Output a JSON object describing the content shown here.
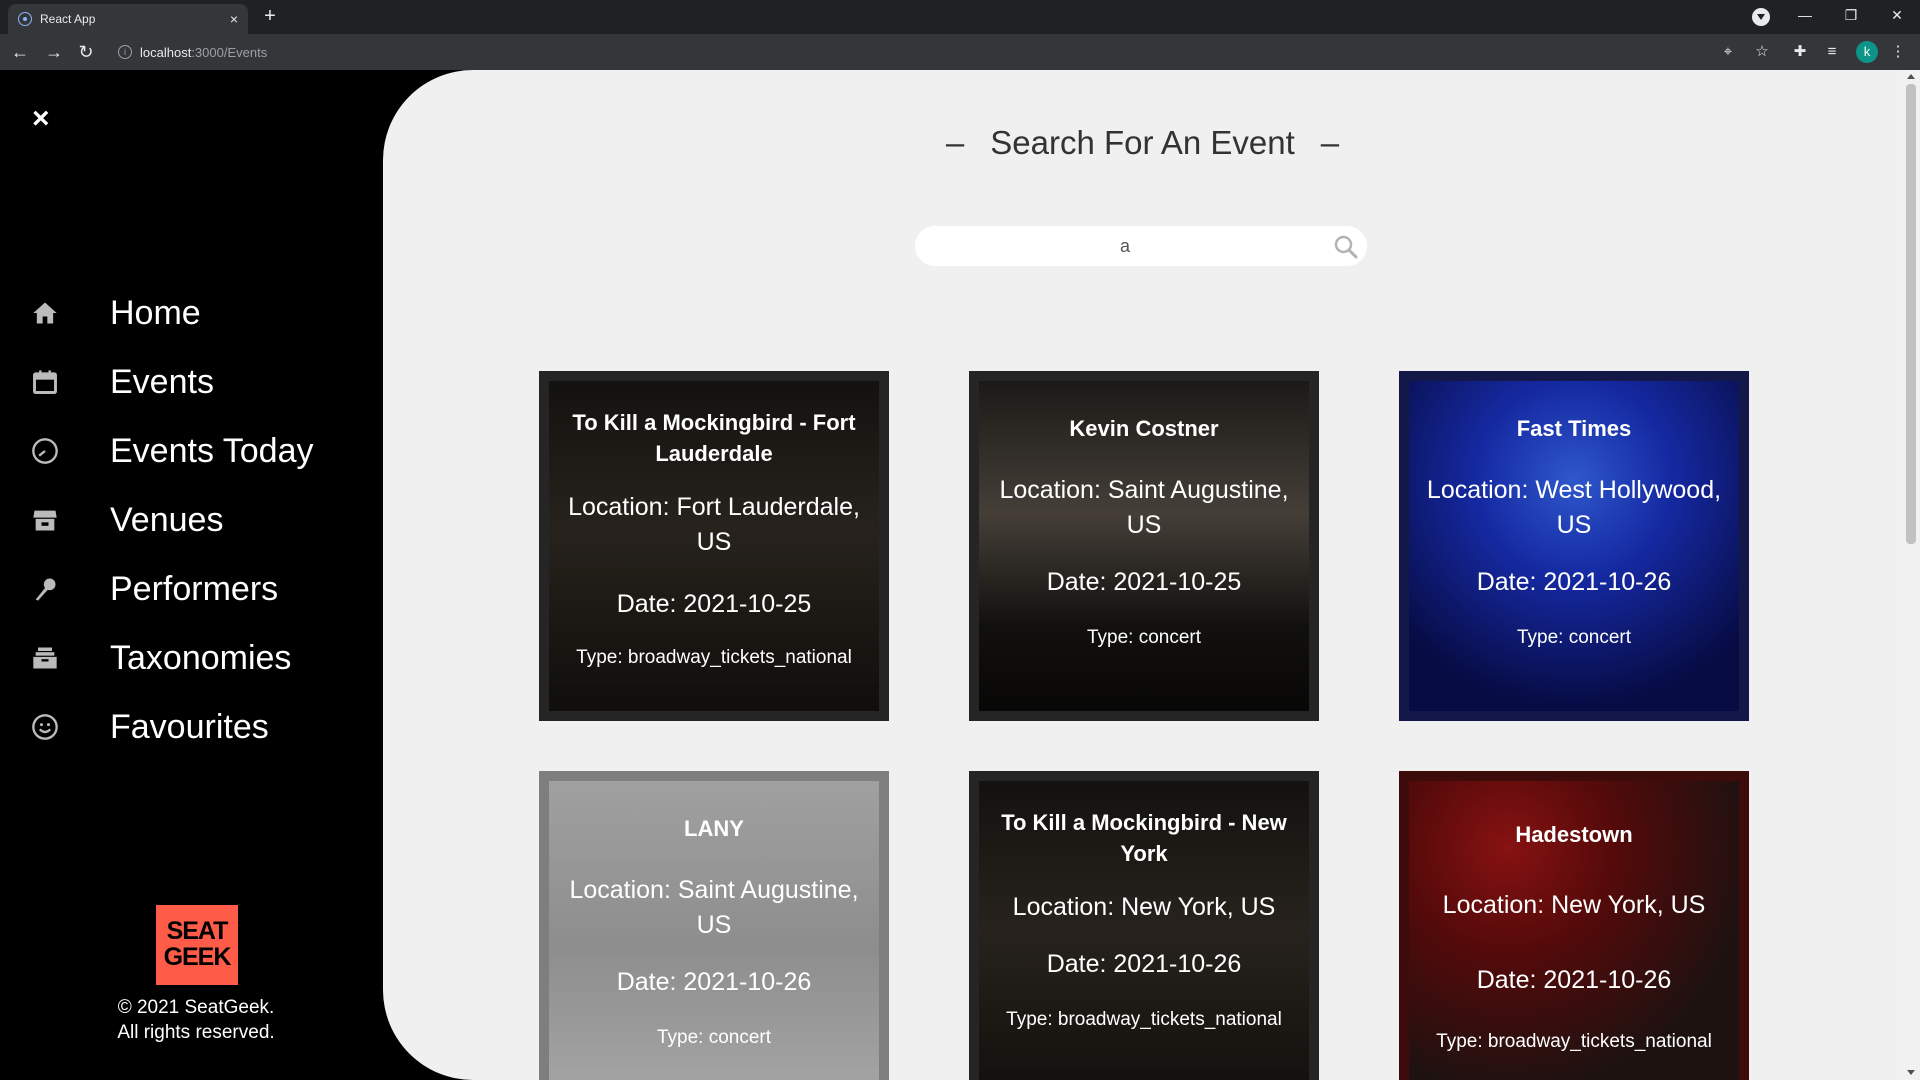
{
  "browser": {
    "tab_title": "React App",
    "tab_close": "×",
    "new_tab": "+",
    "url_host": "localhost",
    "url_path": ":3000/Events",
    "profile_initial": "k"
  },
  "sidebar": {
    "close_symbol": "×",
    "items": [
      {
        "label": "Home",
        "icon": "home-icon"
      },
      {
        "label": "Events",
        "icon": "calendar-icon"
      },
      {
        "label": "Events Today",
        "icon": "clock-icon"
      },
      {
        "label": "Venues",
        "icon": "store-icon"
      },
      {
        "label": "Performers",
        "icon": "microphone-icon"
      },
      {
        "label": "Taxonomies",
        "icon": "tray-icon"
      },
      {
        "label": "Favourites",
        "icon": "smiley-icon"
      }
    ],
    "logo_line1": "SEAT",
    "logo_line2": "GEEK",
    "copyright_line1": "© 2021 SeatGeek.",
    "copyright_line2": "All rights reserved."
  },
  "main": {
    "heading_dash": "–",
    "heading": "Search For An Event",
    "search_value": "a",
    "events": [
      {
        "title": "To Kill a Mockingbird - Fort Lauderdale",
        "location": "Location: Fort Lauderdale, US",
        "date": "Date: 2021-10-25",
        "type": "Type: broadway_tickets_national",
        "theme": "#2a2620"
      },
      {
        "title": "Kevin Costner",
        "location": "Location: Saint Augustine, US",
        "date": "Date: 2021-10-25",
        "type": "Type: concert",
        "theme": "#3b362e"
      },
      {
        "title": "Fast Times",
        "location": "Location: West Hollywood, US",
        "date": "Date: 2021-10-26",
        "type": "Type: concert",
        "theme": "#1b2ba8"
      },
      {
        "title": "LANY",
        "location": "Location: Saint Augustine, US",
        "date": "Date: 2021-10-26",
        "type": "Type: concert",
        "theme": "#b9b9b9"
      },
      {
        "title": "To Kill a Mockingbird - New York",
        "location": "Location: New York, US",
        "date": "Date: 2021-10-26",
        "type": "Type: broadway_tickets_national",
        "theme": "#2a2620"
      },
      {
        "title": "Hadestown",
        "location": "Location: New York, US",
        "date": "Date: 2021-10-26",
        "type": "Type: broadway_tickets_national",
        "theme": "#5a1212"
      }
    ]
  },
  "colors": {
    "sidebar_bg": "#000000",
    "main_bg": "#f0f0f0",
    "logo_bg": "#ff5b49"
  }
}
